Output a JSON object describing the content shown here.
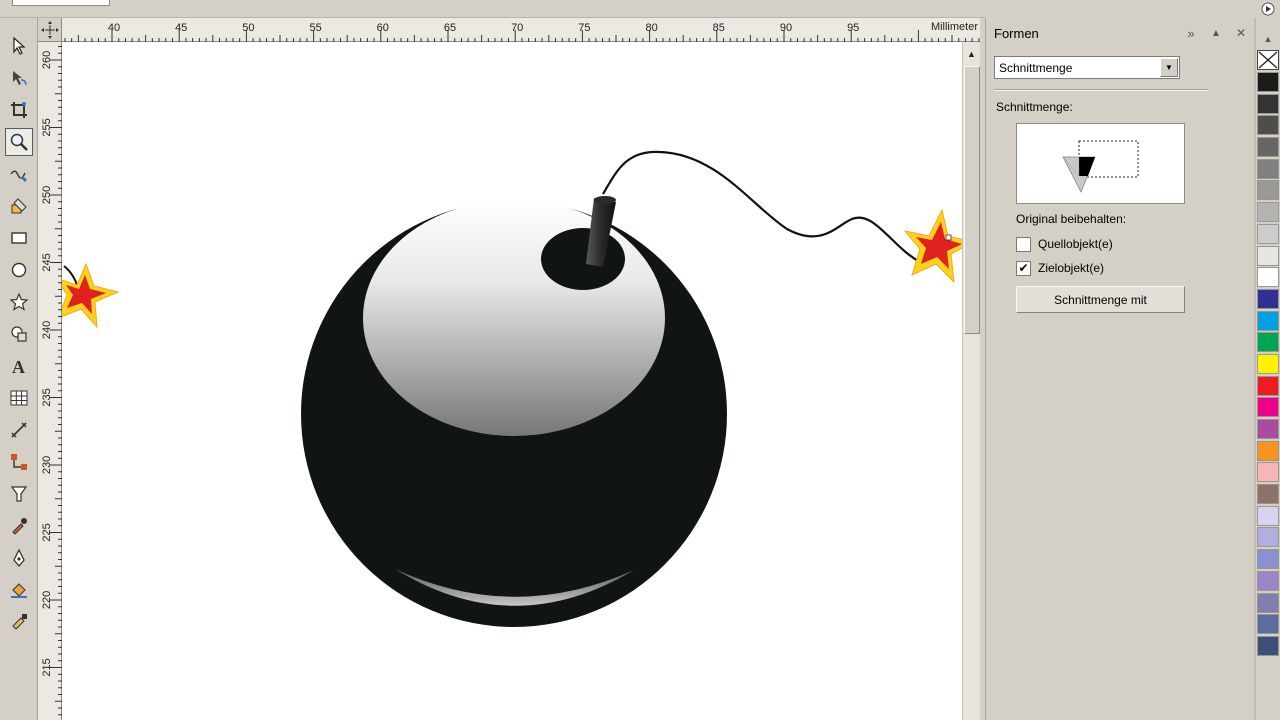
{
  "ruler": {
    "h_ticks": [
      "40",
      "45",
      "50",
      "55",
      "60",
      "65",
      "70",
      "75",
      "80",
      "85",
      "90",
      "95"
    ],
    "v_ticks": [
      "260",
      "255",
      "250",
      "245",
      "240",
      "235",
      "230",
      "225",
      "220",
      "215"
    ],
    "unit": "Millimeter"
  },
  "tools": [
    "pick-tool",
    "shape-tool",
    "crop-tool",
    "zoom-tool",
    "freehand-tool",
    "smart-fill-tool",
    "rectangle-tool",
    "ellipse-tool",
    "polygon-tool",
    "basic-shapes-tool",
    "text-tool",
    "table-tool",
    "dimension-tool",
    "connector-tool",
    "blend-tool",
    "eyedropper-tool",
    "outline-pen-tool",
    "fill-tool",
    "interactive-fill-tool"
  ],
  "docker": {
    "title": "Formen",
    "select_value": "Schnittmenge",
    "section_label": "Schnittmenge:",
    "keep_label": "Original beibehalten:",
    "source_label": "Quellobjekt(e)",
    "target_label": "Zielobjekt(e)",
    "source_checked": false,
    "target_checked": true,
    "apply_label": "Schnittmenge mit",
    "collapse_icon": "»",
    "pin_icon": "▲",
    "close_icon": "✕"
  },
  "palette": {
    "colors": [
      "#1a1a1a",
      "#333333",
      "#4d4d4d",
      "#666666",
      "#808080",
      "#999999",
      "#b3b3b3",
      "#cccccc",
      "#e6e6e6",
      "#ffffff",
      "#2e3192",
      "#00a0e3",
      "#00a651",
      "#fff200",
      "#ed1c24",
      "#ec008c",
      "#a94ba0",
      "#f7941d",
      "#f9b5b5",
      "#8c7269",
      "#d8d4f0",
      "#b3aee0",
      "#8b90d0",
      "#9987c7",
      "#7f7fb0",
      "#5b6d9c",
      "#3d4f7a"
    ]
  }
}
